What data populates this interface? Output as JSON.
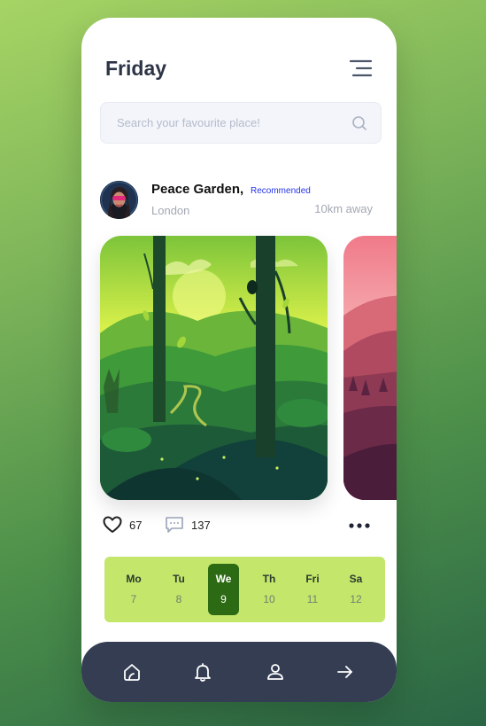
{
  "header": {
    "title": "Friday",
    "menu_icon": "menu-icon"
  },
  "search": {
    "placeholder": "Search your favourite place!",
    "icon": "search-icon"
  },
  "place": {
    "name": "Peace Garden,",
    "tag": "Recommended",
    "city": "London",
    "distance": "10km away",
    "tag_color": "#2533e6"
  },
  "cards": [
    {
      "theme": "green forest landscape illustration"
    },
    {
      "theme": "pink mountain landscape illustration"
    }
  ],
  "stats": {
    "likes": "67",
    "comments": "137"
  },
  "calendar": {
    "days": [
      {
        "name": "Mo",
        "date": "7"
      },
      {
        "name": "Tu",
        "date": "8"
      },
      {
        "name": "We",
        "date": "9"
      },
      {
        "name": "Th",
        "date": "10"
      },
      {
        "name": "Fri",
        "date": "11"
      },
      {
        "name": "Sa",
        "date": "12"
      }
    ],
    "selected": "We",
    "background": "#c4e66a",
    "active_color": "#2d6a14"
  },
  "nav": {
    "icons": [
      "home-icon",
      "bell-icon",
      "user-icon",
      "arrow-right-icon"
    ]
  }
}
